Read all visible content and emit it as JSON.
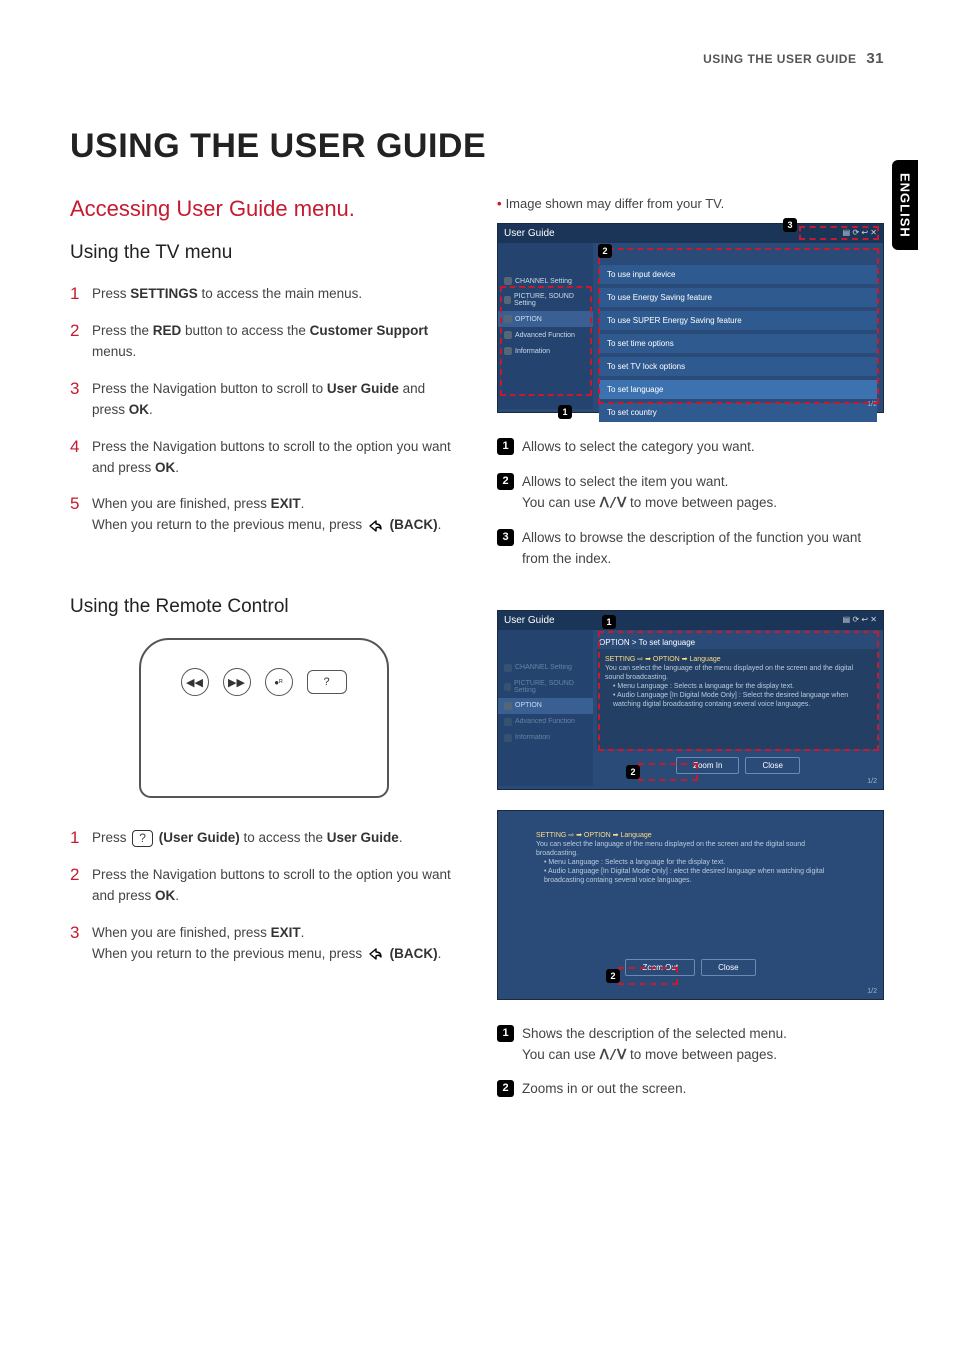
{
  "header": {
    "section": "USING THE USER GUIDE",
    "page": "31"
  },
  "lang_tab": "ENGLISH",
  "title": "USING THE USER GUIDE",
  "left": {
    "h2": "Accessing User Guide menu.",
    "h3a": "Using the TV menu",
    "steps_a": [
      {
        "n": "1",
        "pre": "Press ",
        "b1": "SETTINGS",
        "post": " to access the main menus."
      },
      {
        "n": "2",
        "pre": "Press the ",
        "b1": "RED",
        "mid": " button to access the ",
        "b2": "Customer Support",
        "post": " menus."
      },
      {
        "n": "3",
        "pre": "Press the Navigation button to scroll to ",
        "b1": "User Guide",
        "mid": " and press ",
        "b2": "OK",
        "post": "."
      },
      {
        "n": "4",
        "pre": "Press the Navigation buttons to scroll to the option you want and press ",
        "b1": "OK",
        "post": "."
      },
      {
        "n": "5",
        "pre": "When you are finished, press ",
        "b1": "EXIT",
        "post": ".",
        "line2_pre": "When you return to the previous menu, press ",
        "line2_back": "(BACK)",
        "line2_post": "."
      }
    ],
    "h3b": "Using the Remote Control",
    "steps_b": [
      {
        "n": "1",
        "pre": "Press ",
        "icon": "?",
        "b1": "(User Guide)",
        "mid": " to access the ",
        "b2": "User Guide",
        "post": "."
      },
      {
        "n": "2",
        "pre": "Press the Navigation buttons to scroll to the option you want and press ",
        "b1": "OK",
        "post": "."
      },
      {
        "n": "3",
        "pre": "When you are finished, press ",
        "b1": "EXIT",
        "post": ".",
        "line2_pre": "When you return to the previous menu, press ",
        "line2_back": "(BACK)",
        "line2_post": "."
      }
    ]
  },
  "right": {
    "note": "Image shown may differ from your TV.",
    "shot1": {
      "title": "User Guide",
      "side": [
        "CHANNEL Setting",
        "PICTURE, SOUND Setting",
        "OPTION",
        "Advanced Function",
        "Information"
      ],
      "rows": [
        "To use input device",
        "To use Energy Saving feature",
        "To use SUPER Energy Saving feature",
        "To set time options",
        "To set TV lock options",
        "To set language",
        "To set country"
      ],
      "page": "1/2",
      "c1": "1",
      "c2": "2",
      "c3": "3"
    },
    "legend1": [
      {
        "n": "1",
        "t": "Allows to select the category you want."
      },
      {
        "n": "2",
        "t1": "Allows to select the item you want.",
        "t2_pre": "You can use ",
        "t2_post": " to move between pages."
      },
      {
        "n": "3",
        "t": "Allows to browse the description of the function you want from the index."
      }
    ],
    "shot2": {
      "title": "User Guide",
      "breadcrumb": "OPTION > To set language",
      "side": [
        "CHANNEL Setting",
        "PICTURE, SOUND Setting",
        "OPTION",
        "Advanced Function",
        "Information"
      ],
      "desc_head": "SETTING ⇨ ➡ OPTION ➡ Language",
      "desc_line1": "You can select the language of the menu displayed on the screen and the digital sound broadcasting.",
      "desc_b1": "Menu Language : Selects a language for the display text.",
      "desc_b2": "Audio Language  [In Digital Mode Only] : Select the desired language when watching digital broadcasting containg several voice languages.",
      "btn_zoom": "Zoom In",
      "btn_close": "Close",
      "page": "1/2",
      "c1": "1",
      "c2": "2"
    },
    "shot3": {
      "desc_head": "SETTING ⇨ ➡ OPTION ➡ Language",
      "desc_line1": "You can select the language of the menu displayed on the screen and the digital sound broadcasting.",
      "desc_b1": "Menu Language : Selects a language for the display text.",
      "desc_b2": "Audio Language  [In Digital Mode Only] : elect the desired language when watching digital broadcasting containg several voice languages.",
      "btn_zoom": "Zoom Out",
      "btn_close": "Close",
      "page": "1/2",
      "c2": "2"
    },
    "legend2": [
      {
        "n": "1",
        "t1": "Shows the description of the selected menu.",
        "t2_pre": "You can use ",
        "t2_post": " to move between pages."
      },
      {
        "n": "2",
        "t": "Zooms in or out the screen."
      }
    ]
  }
}
